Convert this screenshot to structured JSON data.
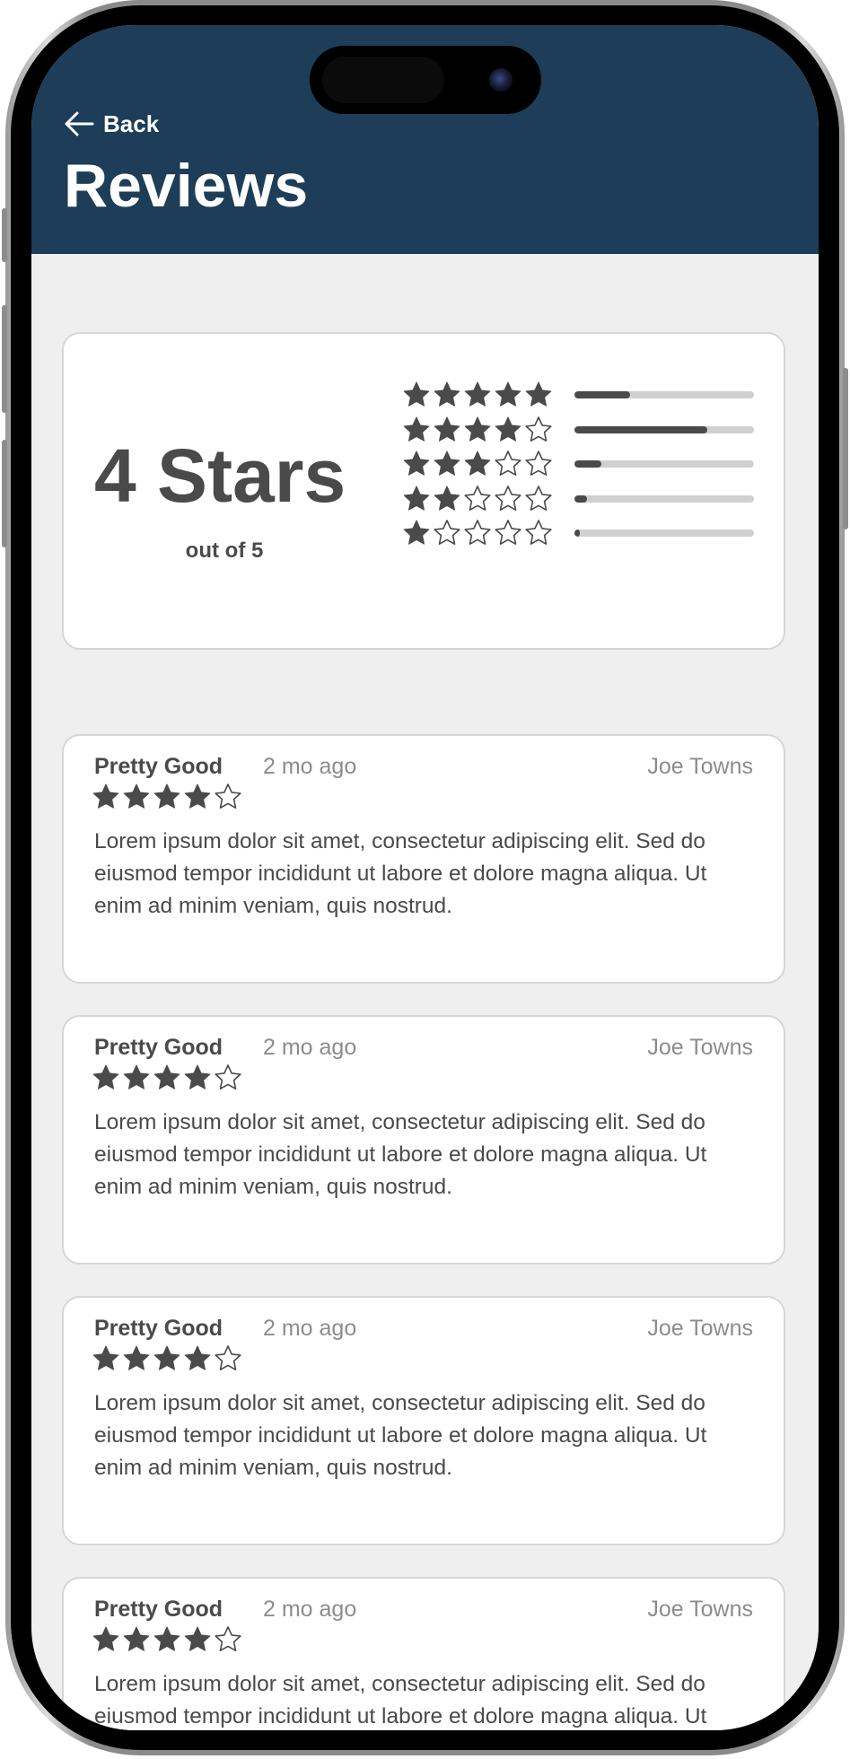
{
  "header": {
    "back_label": "Back",
    "title": "Reviews",
    "background_color": "#1d3d58"
  },
  "summary": {
    "average_label": "4 Stars",
    "average_sub": "out of 5",
    "average_value": 4,
    "max_value": 5,
    "distribution": [
      {
        "stars": 5,
        "share": 0.31
      },
      {
        "stars": 4,
        "share": 0.74
      },
      {
        "stars": 3,
        "share": 0.15
      },
      {
        "stars": 2,
        "share": 0.07
      },
      {
        "stars": 1,
        "share": 0.03
      }
    ]
  },
  "reviews": [
    {
      "title": "Pretty Good",
      "time": "2 mo ago",
      "author": "Joe Towns",
      "rating": 4,
      "body": "Lorem ipsum dolor sit amet, consectetur adipiscing elit. Sed do eiusmod tempor incididunt ut labore et dolore magna aliqua. Ut enim ad minim veniam, quis nostrud."
    },
    {
      "title": "Pretty Good",
      "time": "2 mo ago",
      "author": "Joe Towns",
      "rating": 4,
      "body": "Lorem ipsum dolor sit amet, consectetur adipiscing elit. Sed do eiusmod tempor incididunt ut labore et dolore magna aliqua. Ut enim ad minim veniam, quis nostrud."
    },
    {
      "title": "Pretty Good",
      "time": "2 mo ago",
      "author": "Joe Towns",
      "rating": 4,
      "body": "Lorem ipsum dolor sit amet, consectetur adipiscing elit. Sed do eiusmod tempor incididunt ut labore et dolore magna aliqua. Ut enim ad minim veniam, quis nostrud."
    },
    {
      "title": "Pretty Good",
      "time": "2 mo ago",
      "author": "Joe Towns",
      "rating": 4,
      "body": "Lorem ipsum dolor sit amet, consectetur adipiscing elit. Sed do eiusmod tempor incididunt ut labore et dolore magna aliqua. Ut enim ad minim veniam, quis nostrud."
    }
  ],
  "icons": {
    "back": "arrow-left-icon",
    "star_filled": "star-filled-icon",
    "star_empty": "star-outline-icon"
  },
  "colors": {
    "star": "#4a4a4a",
    "bar_track": "#d0d0d0",
    "bar_fill": "#4a4a4a",
    "screen_bg": "#efefef",
    "card_border": "#d6d6d6"
  }
}
